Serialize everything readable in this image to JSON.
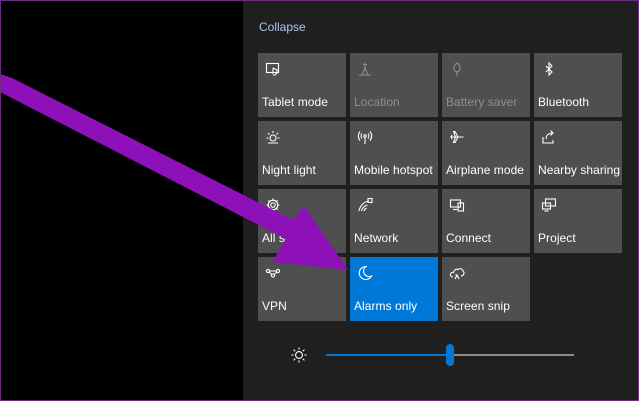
{
  "action_center": {
    "collapse_label": "Collapse",
    "tiles": [
      {
        "label": "Tablet mode",
        "icon": "tablet-mode-icon",
        "state": "off"
      },
      {
        "label": "Location",
        "icon": "location-icon",
        "state": "disabled"
      },
      {
        "label": "Battery saver",
        "icon": "battery-saver-icon",
        "state": "disabled"
      },
      {
        "label": "Bluetooth",
        "icon": "bluetooth-icon",
        "state": "off"
      },
      {
        "label": "Night light",
        "icon": "night-light-icon",
        "state": "off"
      },
      {
        "label": "Mobile hotspot",
        "icon": "mobile-hotspot-icon",
        "state": "off"
      },
      {
        "label": "Airplane mode",
        "icon": "airplane-icon",
        "state": "off"
      },
      {
        "label": "Nearby sharing",
        "icon": "nearby-sharing-icon",
        "state": "off"
      },
      {
        "label": "All settings",
        "icon": "gear-icon",
        "state": "off"
      },
      {
        "label": "Network",
        "icon": "network-icon",
        "state": "off"
      },
      {
        "label": "Connect",
        "icon": "connect-icon",
        "state": "off"
      },
      {
        "label": "Project",
        "icon": "project-icon",
        "state": "off"
      },
      {
        "label": "VPN",
        "icon": "vpn-icon",
        "state": "off"
      },
      {
        "label": "Alarms only",
        "icon": "moon-icon",
        "state": "active"
      },
      {
        "label": "Screen snip",
        "icon": "screen-snip-icon",
        "state": "off"
      }
    ],
    "brightness": {
      "icon": "brightness-icon",
      "level": 0.5
    }
  },
  "annotation": {
    "icon": "purple-arrow",
    "color": "#8e10b8"
  },
  "colors": {
    "accent": "#0078d7",
    "tile_bg": "#4f4f4f",
    "panel_bg": "#1f1f1f",
    "link": "#a8c8ee"
  }
}
